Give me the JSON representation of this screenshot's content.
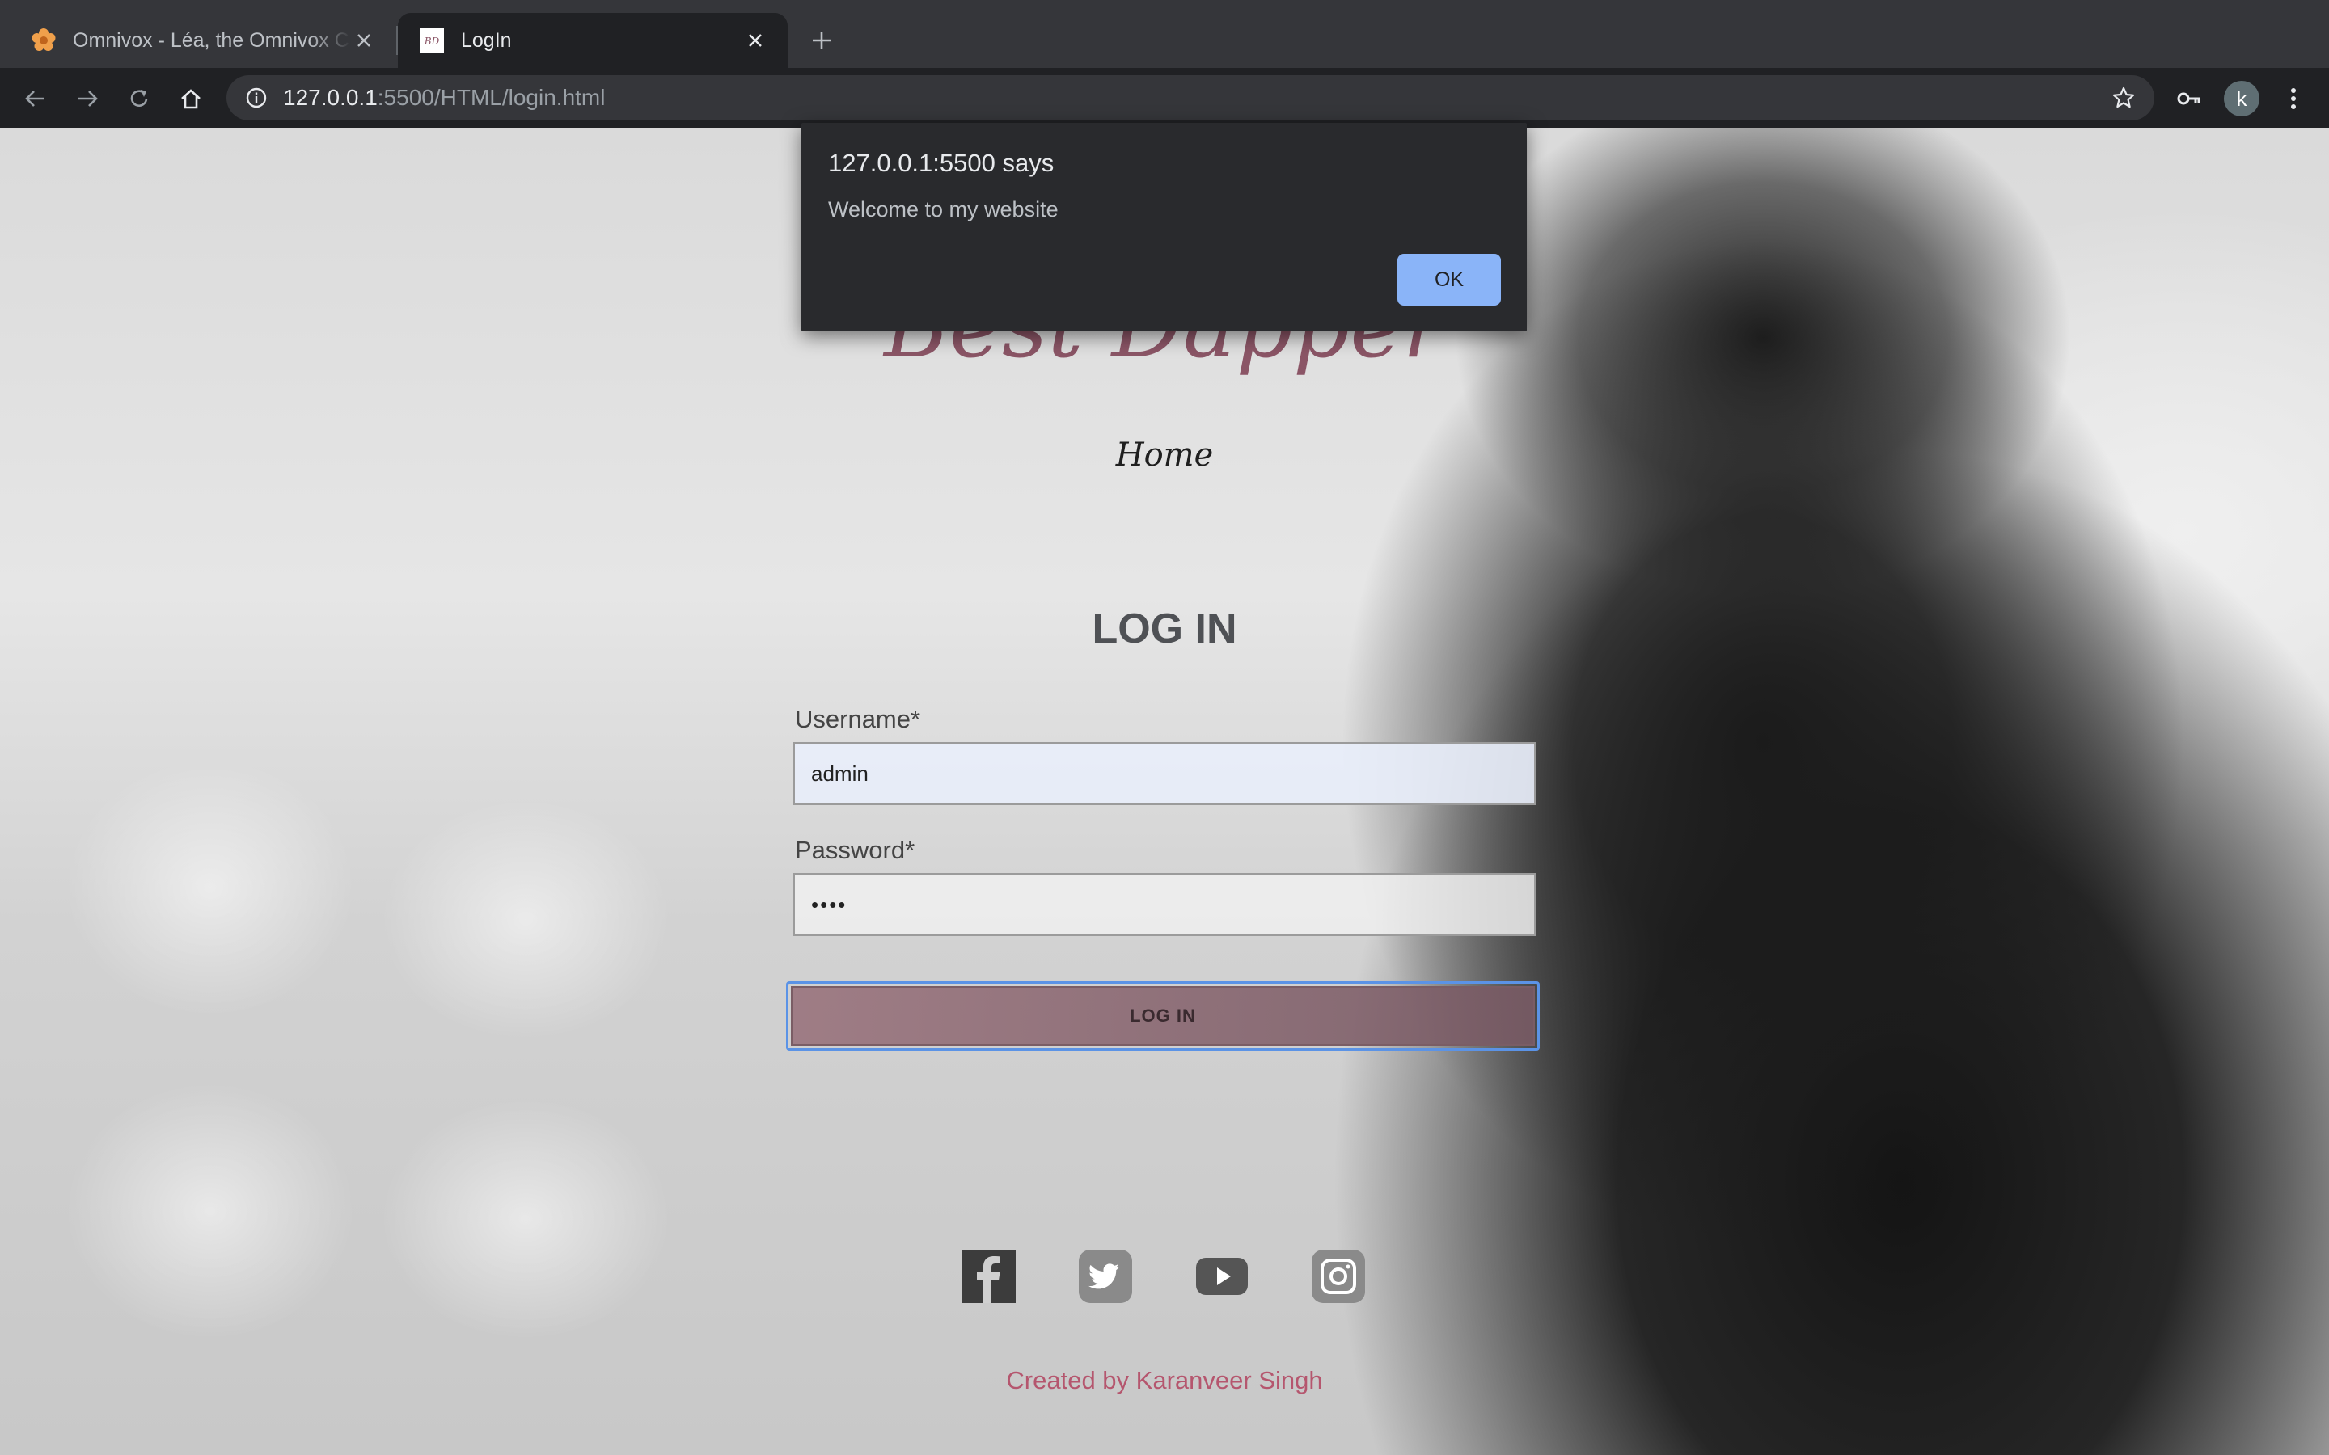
{
  "browser": {
    "tabs": [
      {
        "title": "Omnivox - Léa, the Omnivox Cl",
        "favicon": "omnivox-flower-icon",
        "active": false
      },
      {
        "title": "LogIn",
        "favicon": "site-logo-icon",
        "active": true
      }
    ],
    "url_host": "127.0.0.1",
    "url_rest": ":5500/HTML/login.html",
    "profile_initial": "k"
  },
  "page": {
    "brand": "Best Dapper",
    "nav": {
      "home": "Home"
    },
    "heading": "LOG IN",
    "form": {
      "username_label": "Username*",
      "username_value": "admin",
      "password_label": "Password*",
      "password_value": "••••",
      "submit_label": "LOG IN"
    },
    "social": [
      "facebook-icon",
      "twitter-icon",
      "youtube-icon",
      "instagram-icon"
    ],
    "credit": "Created by Karanveer Singh"
  },
  "alert": {
    "title": "127.0.0.1:5500 says",
    "message": "Welcome to my website",
    "ok_label": "OK"
  },
  "colors": {
    "brand": "#8b5566",
    "credit": "#b5566e",
    "dialog_button": "#8ab4f8"
  }
}
